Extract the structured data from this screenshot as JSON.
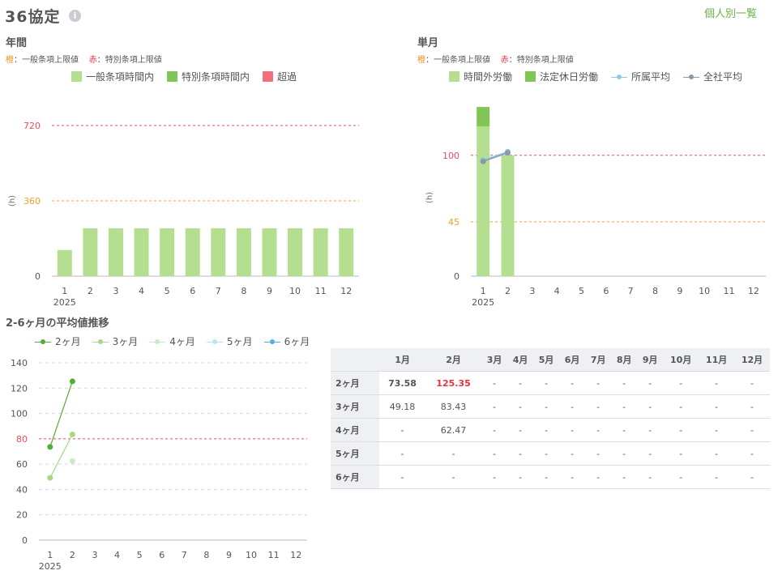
{
  "header": {
    "title": "36協定",
    "info_icon": "info-icon",
    "link_label": "個人別一覧"
  },
  "annual": {
    "title": "年間",
    "note": {
      "orange_key": "橙",
      "orange_desc": "：一般条項上限値",
      "red_key": "赤",
      "red_desc": "：特別条項上限値"
    },
    "legend": [
      "一般条項時間内",
      "特別条項時間内",
      "超過"
    ]
  },
  "monthly": {
    "title": "単月",
    "note": {
      "orange_key": "橙",
      "orange_desc": "：一般条項上限値",
      "red_key": "赤",
      "red_desc": "：特別条項上限値"
    },
    "legend": [
      "時間外労働",
      "法定休日労働",
      "所属平均",
      "全社平均"
    ]
  },
  "trend": {
    "title": "2-6ヶ月の平均値推移",
    "legend": [
      "2ヶ月",
      "3ヶ月",
      "4ヶ月",
      "5ヶ月",
      "6ヶ月"
    ]
  },
  "colors": {
    "light_green": "#b5df90",
    "green": "#80c556",
    "red": "#f0707d",
    "orange_line": "#f0a030",
    "red_line": "#ee4b5f",
    "dept_avg": "#8ec9ea",
    "company_avg": "#8a9aa8",
    "s2": "#56ad34",
    "s3": "#a4d985",
    "s4": "#c8ecc8",
    "s5": "#bde2f3",
    "s6": "#5aaee6"
  },
  "chart_data": [
    {
      "id": "annual",
      "type": "bar",
      "categories": [
        "1",
        "2",
        "3",
        "4",
        "5",
        "6",
        "7",
        "8",
        "9",
        "10",
        "11",
        "12"
      ],
      "x_year_label": "2025",
      "ylabel": "(h)",
      "yticks": [
        0,
        360,
        720
      ],
      "ylim": [
        0,
        720
      ],
      "ref_lines": [
        {
          "value": 360,
          "color": "orange"
        },
        {
          "value": 720,
          "color": "red"
        }
      ],
      "series": [
        {
          "name": "一般条項時間内",
          "values": [
            125,
            229,
            229,
            229,
            229,
            229,
            229,
            229,
            229,
            229,
            229,
            229
          ]
        }
      ]
    },
    {
      "id": "monthly",
      "type": "bar",
      "categories": [
        "1",
        "2",
        "3",
        "4",
        "5",
        "6",
        "7",
        "8",
        "9",
        "10",
        "11",
        "12"
      ],
      "x_year_label": "2025",
      "ylabel": "(h)",
      "yticks": [
        0,
        45,
        100
      ],
      "ylim": [
        0,
        130
      ],
      "ref_lines": [
        {
          "value": 45,
          "color": "orange"
        },
        {
          "value": 100,
          "color": "red"
        }
      ],
      "series": [
        {
          "name": "時間外労働",
          "values": [
            124,
            100,
            null,
            null,
            null,
            null,
            null,
            null,
            null,
            null,
            null,
            null
          ]
        },
        {
          "name": "法定休日労働",
          "values": [
            16,
            0,
            null,
            null,
            null,
            null,
            null,
            null,
            null,
            null,
            null,
            null
          ]
        },
        {
          "name": "所属平均",
          "values": [
            96,
            103,
            null,
            null,
            null,
            null,
            null,
            null,
            null,
            null,
            null,
            null
          ]
        },
        {
          "name": "全社平均",
          "values": [
            95,
            102,
            null,
            null,
            null,
            null,
            null,
            null,
            null,
            null,
            null,
            null
          ]
        }
      ]
    },
    {
      "id": "trend",
      "type": "line",
      "categories": [
        "1",
        "2",
        "3",
        "4",
        "5",
        "6",
        "7",
        "8",
        "9",
        "10",
        "11",
        "12"
      ],
      "x_year_label": "2025",
      "yticks": [
        0,
        20,
        40,
        60,
        80,
        100,
        120,
        140
      ],
      "ylim": [
        0,
        140
      ],
      "ref_lines": [
        {
          "value": 80,
          "color": "red"
        }
      ],
      "series": [
        {
          "name": "2ヶ月",
          "values": [
            73.58,
            125.35,
            null,
            null,
            null,
            null,
            null,
            null,
            null,
            null,
            null,
            null
          ]
        },
        {
          "name": "3ヶ月",
          "values": [
            49.18,
            83.43,
            null,
            null,
            null,
            null,
            null,
            null,
            null,
            null,
            null,
            null
          ]
        },
        {
          "name": "4ヶ月",
          "values": [
            null,
            62.47,
            null,
            null,
            null,
            null,
            null,
            null,
            null,
            null,
            null,
            null
          ]
        },
        {
          "name": "5ヶ月",
          "values": [
            null,
            null,
            null,
            null,
            null,
            null,
            null,
            null,
            null,
            null,
            null,
            null
          ]
        },
        {
          "name": "6ヶ月",
          "values": [
            null,
            null,
            null,
            null,
            null,
            null,
            null,
            null,
            null,
            null,
            null,
            null
          ]
        }
      ]
    }
  ],
  "table": {
    "months": [
      "1月",
      "2月",
      "3月",
      "4月",
      "5月",
      "6月",
      "7月",
      "8月",
      "9月",
      "10月",
      "11月",
      "12月"
    ],
    "rows": [
      {
        "label": "2ヶ月",
        "values": [
          "73.58",
          "125.35",
          "-",
          "-",
          "-",
          "-",
          "-",
          "-",
          "-",
          "-",
          "-",
          "-"
        ]
      },
      {
        "label": "3ヶ月",
        "values": [
          "49.18",
          "83.43",
          "-",
          "-",
          "-",
          "-",
          "-",
          "-",
          "-",
          "-",
          "-",
          "-"
        ]
      },
      {
        "label": "4ヶ月",
        "values": [
          "-",
          "62.47",
          "-",
          "-",
          "-",
          "-",
          "-",
          "-",
          "-",
          "-",
          "-",
          "-"
        ]
      },
      {
        "label": "5ヶ月",
        "values": [
          "-",
          "-",
          "-",
          "-",
          "-",
          "-",
          "-",
          "-",
          "-",
          "-",
          "-",
          "-"
        ]
      },
      {
        "label": "6ヶ月",
        "values": [
          "-",
          "-",
          "-",
          "-",
          "-",
          "-",
          "-",
          "-",
          "-",
          "-",
          "-",
          "-"
        ]
      }
    ]
  }
}
